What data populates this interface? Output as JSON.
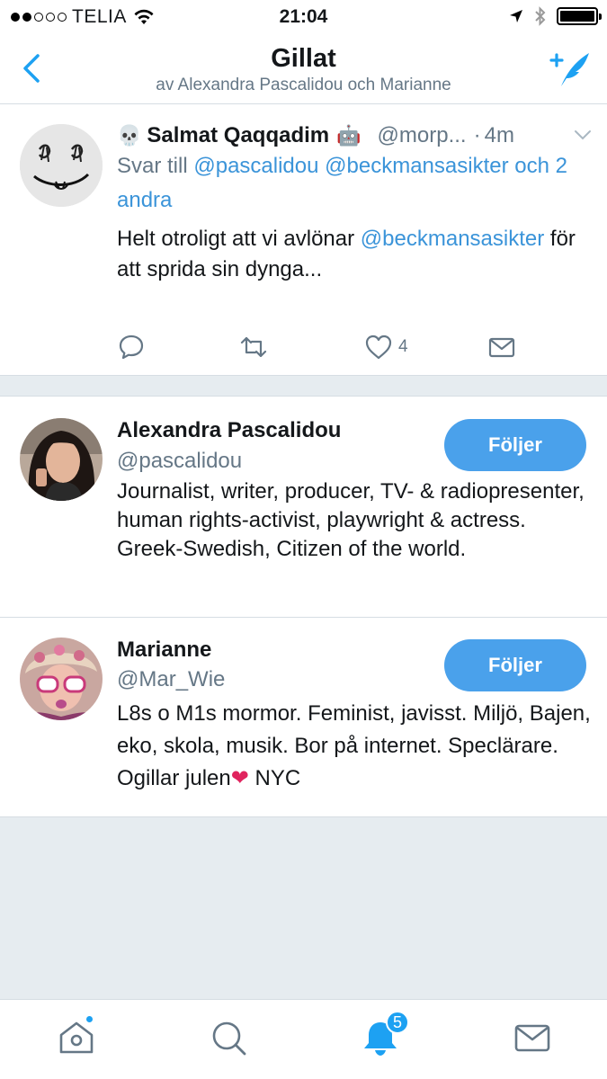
{
  "status_bar": {
    "carrier": "TELIA",
    "time": "21:04"
  },
  "nav": {
    "title": "Gillat",
    "subtitle": "av Alexandra Pascalidou och Marianne"
  },
  "tweet": {
    "name": "Salmat Qaqqadim",
    "handle": "@morp...",
    "separator": "·",
    "time": "4m",
    "reply_prefix": "Svar till",
    "reply_mention_1": "@pascalidou",
    "reply_mention_2": "@beckmansasikter",
    "reply_others": "och 2 andra",
    "text_1": "Helt otroligt att vi avlönar",
    "text_mention": "@beckmansasikter",
    "text_2": "för att sprida sin dynga...",
    "like_count": "4"
  },
  "users": [
    {
      "name": "Alexandra Pascalidou",
      "handle": "@pascalidou",
      "bio": "Journalist, writer, producer, TV- & radiopresenter, human rights-activist, playwright & actress. Greek-Swedish, Citizen of the world.",
      "button_label": "Följer"
    },
    {
      "name": "Marianne",
      "handle": "@Mar_Wie",
      "bio_1": "L8s o M1s mormor. Feminist, javisst. Miljö, Bajen, eko, skola, musik. Bor på internet. Speclärare. Ogillar julen",
      "bio_emoji": "❤",
      "bio_2": "NYC",
      "button_label": "Följer"
    }
  ],
  "tab_bar": {
    "notifications_badge": "5"
  },
  "colors": {
    "accent": "#1da1f2",
    "link": "#3b94d9",
    "button": "#4aa1eb",
    "muted": "#657786",
    "background": "#e6ecf0"
  },
  "icons": [
    "back-arrow-icon",
    "compose-tweet-icon",
    "chevron-down-icon",
    "reply-icon",
    "retweet-icon",
    "like-icon",
    "direct-message-icon",
    "home-icon",
    "search-icon",
    "notifications-icon",
    "messages-icon"
  ]
}
